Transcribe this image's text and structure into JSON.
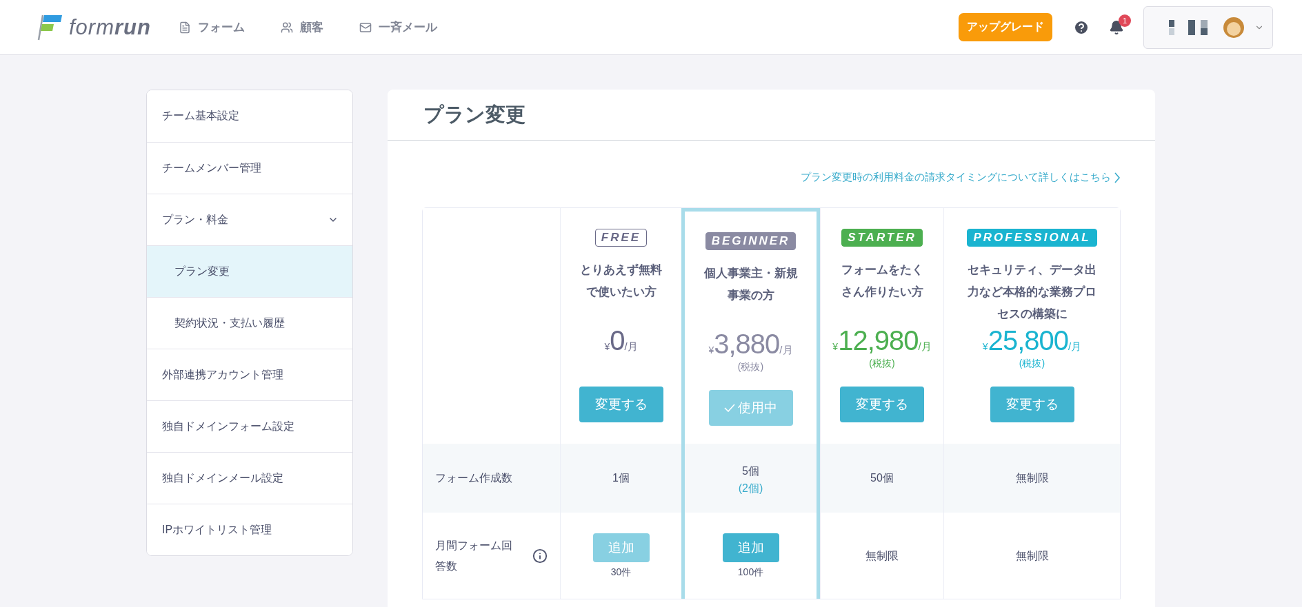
{
  "header": {
    "logo": "form**run**",
    "nav": [
      {
        "kind": "form",
        "label": "フォーム"
      },
      {
        "kind": "customers",
        "label": "顧客"
      },
      {
        "kind": "mail",
        "label": "一斉メール"
      }
    ],
    "upgrade": "アップグレード",
    "notification_count": "1"
  },
  "sidebar": {
    "items": [
      {
        "label": "チーム基本設定",
        "selected": false
      },
      {
        "label": "チームメンバー管理",
        "selected": false
      },
      {
        "label": "プラン・料金",
        "selected": false,
        "expanded": true,
        "children": [
          {
            "label": "プラン変更",
            "selected": true
          },
          {
            "label": "契約状況・支払い履歴",
            "selected": false
          }
        ]
      },
      {
        "label": "外部連携アカウント管理",
        "selected": false
      },
      {
        "label": "独自ドメインフォーム設定",
        "selected": false
      },
      {
        "label": "独自ドメインメール設定",
        "selected": false
      },
      {
        "label": "IPホワイトリスト管理",
        "selected": false
      }
    ]
  },
  "page": {
    "title": "プラン変更",
    "link": "プラン変更時の利用料金の請求タイミングについて詳しくはこちら"
  },
  "plans": [
    {
      "badge": "FREE",
      "kind": "outline",
      "color": "#6a6a88",
      "description": "とりあえず無料で使いたい方",
      "currency": "¥",
      "price": "0",
      "unit": "/月",
      "button": "変更する",
      "selected": false
    },
    {
      "badge": "BEGINNER",
      "kind": "filled",
      "color": "#8a8aa2",
      "description": "個人事業主・新規事業の方",
      "currency": "¥",
      "price": "3,880",
      "unit": "/月",
      "tax": "(税抜)",
      "button": "使用中",
      "selected": true
    },
    {
      "badge": "STARTER",
      "kind": "filled",
      "color": "#4caf50",
      "description": "フォームをたくさん作りたい方",
      "currency": "¥",
      "price": "12,980",
      "unit": "/月",
      "tax": "(税抜)",
      "button": "変更する",
      "selected": false
    },
    {
      "badge": "PROFESSIONAL",
      "kind": "filled",
      "color": "#1ab4d0",
      "description": "セキュリティ、データ出力など本格的な業務プロセスの構築に",
      "currency": "¥",
      "price": "25,800",
      "unit": "/月",
      "tax": "(税抜)",
      "button": "変更する",
      "selected": false
    }
  ],
  "rows": [
    {
      "label": "フォーム作成数",
      "info": false,
      "cells": [
        {
          "kind": "text",
          "value": "1個"
        },
        {
          "kind": "text",
          "value": "5個",
          "note": "(2個)"
        },
        {
          "kind": "text",
          "value": "50個"
        },
        {
          "kind": "text",
          "value": "無制限"
        }
      ]
    },
    {
      "label": "月間フォーム回答数",
      "info": true,
      "cells": [
        {
          "kind": "button",
          "label": "追加",
          "disabled": true,
          "count": "30件"
        },
        {
          "kind": "button",
          "label": "追加",
          "disabled": false,
          "count": "100件"
        },
        {
          "kind": "text",
          "value": "無制限"
        },
        {
          "kind": "text",
          "value": "無制限"
        }
      ]
    }
  ]
}
